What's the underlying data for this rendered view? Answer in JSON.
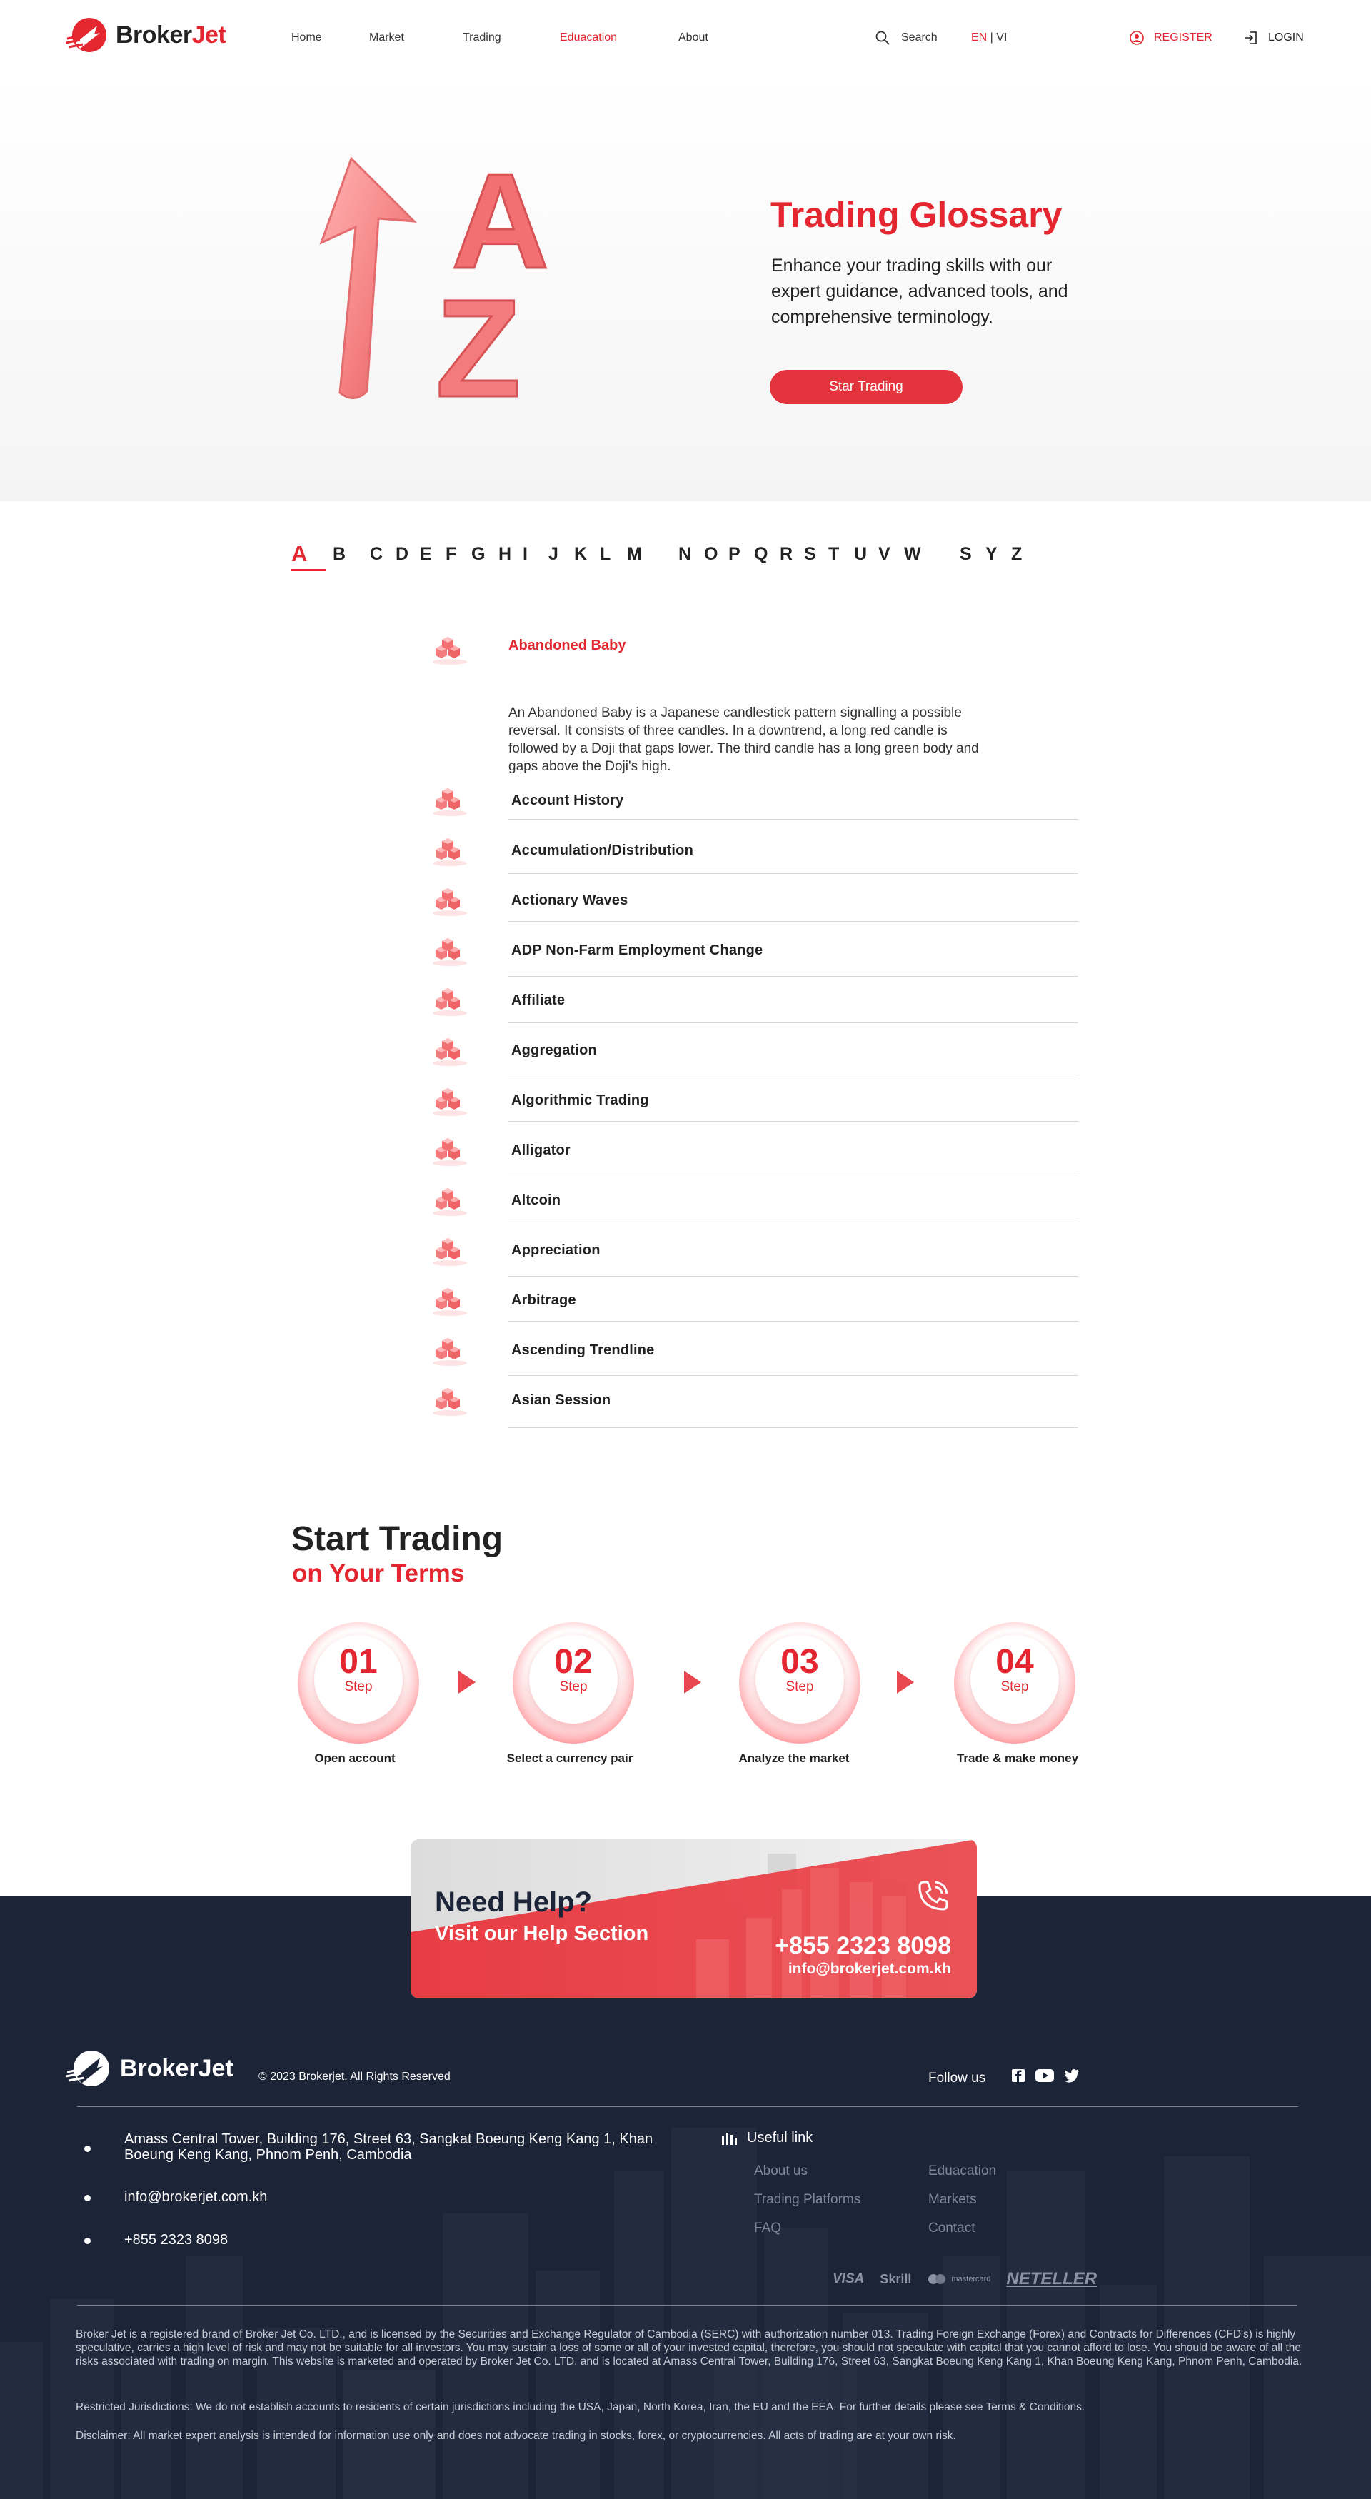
{
  "nav": {
    "brand_a": "Broker",
    "brand_b": "Jet",
    "links": [
      "Home",
      "Market",
      "Trading",
      "Eduacation",
      "About"
    ],
    "search_label": "Search",
    "lang_en": "EN",
    "lang_sep": " | ",
    "lang_vi": "VI",
    "register": "REGISTER",
    "login": "LOGIN"
  },
  "hero": {
    "title": "Trading Glossary",
    "subtitle": "Enhance your trading skills with our expert guidance, advanced tools, and comprehensive terminology.",
    "button": "Star Trading",
    "art_letter_a": "A",
    "art_letter_z": "Z"
  },
  "alphabet": [
    "A",
    "B",
    "C",
    "D",
    "E",
    "F",
    "G",
    "H",
    "I",
    "J",
    "K",
    "L",
    "M",
    "N",
    "O",
    "P",
    "Q",
    "R",
    "S",
    "T",
    "U",
    "V",
    "W",
    "S",
    "Y",
    "Z"
  ],
  "alphabet_active": "A",
  "glossary": {
    "first_term": "Abandoned Baby",
    "first_desc": "An Abandoned Baby is a Japanese candlestick pattern signalling a possible reversal. It consists of three candles. In a downtrend, a long red candle is followed by a Doji that gaps lower. The third candle has a long green body and gaps above the Doji's high.",
    "terms": [
      "Account History",
      "Accumulation/Distribution",
      "Actionary Waves",
      "ADP Non-Farm Employment Change",
      "Affiliate",
      "Aggregation",
      "Algorithmic Trading",
      "Alligator",
      "Altcoin",
      "Appreciation",
      "Arbitrage",
      "Ascending Trendline",
      "Asian Session"
    ]
  },
  "start_trading": {
    "title": "Start Trading",
    "subtitle": "on Your Terms",
    "steps": [
      {
        "num": "01",
        "word": "Step",
        "label": "Open account"
      },
      {
        "num": "02",
        "word": "Step",
        "label": "Select a currency pair"
      },
      {
        "num": "03",
        "word": "Step",
        "label": "Analyze the market"
      },
      {
        "num": "04",
        "word": "Step",
        "label": "Trade & make money"
      }
    ]
  },
  "help": {
    "title": "Need Help?",
    "subtitle": "Visit our Help Section",
    "phone": "+855 2323 8098",
    "email": "info@brokerjet.com.kh"
  },
  "footer": {
    "brand": "BrokerJet",
    "copyright": "© 2023 Brokerjet. All Rights Reserved",
    "follow": "Follow us",
    "address": "Amass Central Tower, Building 176, Street 63, Sangkat Boeung Keng Kang 1, Khan Boeung Keng Kang, Phnom Penh, Cambodia",
    "email": "info@brokerjet.com.kh",
    "phone": "+855 2323 8098",
    "useful_title": "Useful link",
    "links_left": [
      "About us",
      "Trading Platforms",
      "FAQ"
    ],
    "links_right": [
      "Eduacation",
      "Markets",
      "Contact"
    ],
    "payments": [
      "VISA",
      "Skrill",
      "mastercard",
      "NETELLER"
    ],
    "legal_1": "Broker Jet is a registered brand of Broker Jet Co. LTD., and is licensed by the Securities and Exchange Regulator of Cambodia (SERC) with authorization number 013. Trading Foreign Exchange (Forex) and Contracts for Differences (CFD's) is highly speculative, carries a high level of risk and may not be suitable for all investors. You may sustain a loss of some or all of your invested capital, therefore, you should not speculate with capital that you cannot afford to lose. You should be aware of all the risks associated with trading on margin. This website is marketed and operated by Broker Jet Co. LTD. and is located at Amass Central Tower, Building 176, Street 63, Sangkat Boeung Keng Kang 1, Khan Boeung Keng Kang, Phnom Penh, Cambodia.",
    "legal_2": "Restricted Jurisdictions: We do not establish accounts to residents of certain jurisdictions including the USA, Japan, North Korea, Iran, the EU and the EEA. For further details please see Terms & Conditions.",
    "legal_3": "Disclaimer: All market expert analysis is intended for information use only and does not advocate trading in stocks, forex, or cryptocurrencies. All acts of trading are at your own risk."
  },
  "colors": {
    "brand_red": "#e3262f",
    "footer_navy": "#1c2437"
  }
}
